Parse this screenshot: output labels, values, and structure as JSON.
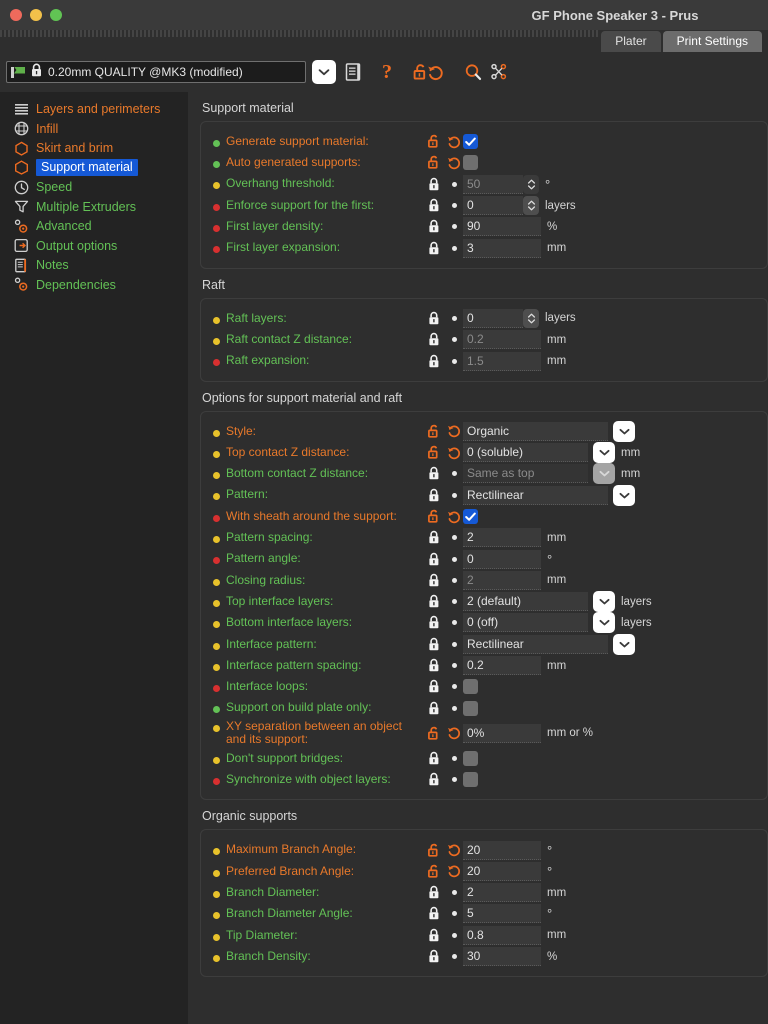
{
  "window": {
    "title": "GF Phone Speaker 3 - Prus",
    "controls": [
      "close-button",
      "minimize-button",
      "zoom-button"
    ]
  },
  "tabs": [
    {
      "label": "Plater",
      "active": false
    },
    {
      "label": "Print Settings",
      "active": true
    }
  ],
  "toolbar": {
    "preset_value": "0.20mm QUALITY @MK3 (modified)",
    "icons": [
      "combo-arrow-icon",
      "save-preset-icon",
      "question-mark-icon",
      "unlock-icon",
      "revert-icon",
      "search-icon",
      "compare-presets-icon"
    ]
  },
  "sidebar": {
    "items": [
      {
        "label": "Layers and perimeters",
        "icon": "layers-icon",
        "color": "orange",
        "selected": false
      },
      {
        "label": "Infill",
        "icon": "infill-icon",
        "color": "orange",
        "selected": false
      },
      {
        "label": "Skirt and brim",
        "icon": "skirt-icon",
        "color": "orange",
        "selected": false
      },
      {
        "label": "Support material",
        "icon": "support-icon",
        "color": "orange",
        "selected": true
      },
      {
        "label": "Speed",
        "icon": "speed-icon",
        "color": "green",
        "selected": false
      },
      {
        "label": "Multiple Extruders",
        "icon": "extruder-icon",
        "color": "green",
        "selected": false
      },
      {
        "label": "Advanced",
        "icon": "advanced-icon",
        "color": "green",
        "selected": false
      },
      {
        "label": "Output options",
        "icon": "output-icon",
        "color": "green",
        "selected": false
      },
      {
        "label": "Notes",
        "icon": "notes-icon",
        "color": "green",
        "selected": false
      },
      {
        "label": "Dependencies",
        "icon": "dependencies-icon",
        "color": "green",
        "selected": false
      }
    ]
  },
  "sections": [
    {
      "title": "Support material",
      "rows": [
        {
          "label": "Generate support material:",
          "label_color": "orange",
          "bullet": "#63c156",
          "lock": "unlocked",
          "revert": "arrow",
          "widget": "checkbox",
          "value": "checked"
        },
        {
          "label": "Auto generated supports:",
          "label_color": "orange",
          "bullet": "#63c156",
          "lock": "unlocked",
          "revert": "arrow",
          "widget": "checkbox",
          "value": "unchecked"
        },
        {
          "label": "Overhang threshold:",
          "label_color": "green",
          "bullet": "#e8c22b",
          "lock": "locked",
          "revert": "dot",
          "widget": "spinner",
          "value": "50",
          "disabled": true,
          "unit": "°"
        },
        {
          "label": "Enforce support for the first:",
          "label_color": "green",
          "bullet": "#d83030",
          "lock": "locked",
          "revert": "dot",
          "widget": "spinner",
          "value": "0",
          "unit": "layers"
        },
        {
          "label": "First layer density:",
          "label_color": "green",
          "bullet": "#d83030",
          "lock": "locked",
          "revert": "dot",
          "widget": "text",
          "value": "90",
          "unit": "%"
        },
        {
          "label": "First layer expansion:",
          "label_color": "green",
          "bullet": "#d83030",
          "lock": "locked",
          "revert": "dot",
          "widget": "text",
          "value": "3",
          "unit": "mm"
        }
      ]
    },
    {
      "title": "Raft",
      "rows": [
        {
          "label": "Raft layers:",
          "label_color": "green",
          "bullet": "#e8c22b",
          "lock": "locked",
          "revert": "dot",
          "widget": "spinner",
          "value": "0",
          "unit": "layers"
        },
        {
          "label": "Raft contact Z distance:",
          "label_color": "green",
          "bullet": "#e8c22b",
          "lock": "locked",
          "revert": "dot",
          "widget": "text",
          "value": "0.2",
          "disabled": true,
          "unit": "mm"
        },
        {
          "label": "Raft expansion:",
          "label_color": "green",
          "bullet": "#d83030",
          "lock": "locked",
          "revert": "dot",
          "widget": "text",
          "value": "1.5",
          "disabled": true,
          "unit": "mm"
        }
      ]
    },
    {
      "title": "Options for support material and raft",
      "rows": [
        {
          "label": "Style:",
          "label_color": "orange",
          "bullet": "#e8c22b",
          "lock": "unlocked",
          "revert": "arrow",
          "widget": "dropdown",
          "value": "Organic",
          "unit": ""
        },
        {
          "label": "Top contact Z distance:",
          "label_color": "orange",
          "bullet": "#e8c22b",
          "lock": "unlocked",
          "revert": "arrow",
          "widget": "dropdown",
          "value": "0 (soluble)",
          "unit": "mm"
        },
        {
          "label": "Bottom contact Z distance:",
          "label_color": "green",
          "bullet": "#e8c22b",
          "lock": "locked",
          "revert": "dot",
          "widget": "dropdown",
          "value": "Same as top",
          "disabled": true,
          "unit": "mm"
        },
        {
          "label": "Pattern:",
          "label_color": "green",
          "bullet": "#e8c22b",
          "lock": "locked",
          "revert": "dot",
          "widget": "dropdown",
          "value": "Rectilinear",
          "unit": ""
        },
        {
          "label": "With sheath around the support:",
          "label_color": "orange",
          "bullet": "#d83030",
          "lock": "unlocked",
          "revert": "arrow",
          "widget": "checkbox",
          "value": "checked"
        },
        {
          "label": "Pattern spacing:",
          "label_color": "green",
          "bullet": "#e8c22b",
          "lock": "locked",
          "revert": "dot",
          "widget": "text",
          "value": "2",
          "unit": "mm"
        },
        {
          "label": "Pattern angle:",
          "label_color": "green",
          "bullet": "#d83030",
          "lock": "locked",
          "revert": "dot",
          "widget": "text",
          "value": "0",
          "unit": "°"
        },
        {
          "label": "Closing radius:",
          "label_color": "green",
          "bullet": "#e8c22b",
          "lock": "locked",
          "revert": "dot",
          "widget": "text",
          "value": "2",
          "disabled": true,
          "unit": "mm"
        },
        {
          "label": "Top interface layers:",
          "label_color": "green",
          "bullet": "#e8c22b",
          "lock": "locked",
          "revert": "dot",
          "widget": "dropdown",
          "value": "2 (default)",
          "unit": "layers"
        },
        {
          "label": "Bottom interface layers:",
          "label_color": "green",
          "bullet": "#e8c22b",
          "lock": "locked",
          "revert": "dot",
          "widget": "dropdown",
          "value": "0 (off)",
          "unit": "layers"
        },
        {
          "label": "Interface pattern:",
          "label_color": "green",
          "bullet": "#e8c22b",
          "lock": "locked",
          "revert": "dot",
          "widget": "dropdown",
          "value": "Rectilinear",
          "unit": ""
        },
        {
          "label": "Interface pattern spacing:",
          "label_color": "green",
          "bullet": "#e8c22b",
          "lock": "locked",
          "revert": "dot",
          "widget": "text",
          "value": "0.2",
          "unit": "mm"
        },
        {
          "label": "Interface loops:",
          "label_color": "green",
          "bullet": "#d83030",
          "lock": "locked",
          "revert": "dot",
          "widget": "checkbox",
          "value": "unchecked"
        },
        {
          "label": "Support on build plate only:",
          "label_color": "green",
          "bullet": "#63c156",
          "lock": "locked",
          "revert": "dot",
          "widget": "checkbox",
          "value": "unchecked"
        },
        {
          "label": "XY separation between an object and its support:",
          "label_color": "orange",
          "bullet": "#e8c22b",
          "lock": "unlocked",
          "revert": "arrow",
          "widget": "text",
          "value": "0%",
          "unit": "mm or %",
          "two_line": true
        },
        {
          "label": "Don't support bridges:",
          "label_color": "green",
          "bullet": "#e8c22b",
          "lock": "locked",
          "revert": "dot",
          "widget": "checkbox",
          "value": "unchecked"
        },
        {
          "label": "Synchronize with object layers:",
          "label_color": "green",
          "bullet": "#d83030",
          "lock": "locked",
          "revert": "dot",
          "widget": "checkbox",
          "value": "unchecked"
        }
      ]
    },
    {
      "title": "Organic supports",
      "rows": [
        {
          "label": "Maximum Branch Angle:",
          "label_color": "orange",
          "bullet": "#e8c22b",
          "lock": "unlocked",
          "revert": "arrow",
          "widget": "text",
          "value": "20",
          "unit": "°"
        },
        {
          "label": "Preferred Branch Angle:",
          "label_color": "orange",
          "bullet": "#e8c22b",
          "lock": "unlocked",
          "revert": "arrow",
          "widget": "text",
          "value": "20",
          "unit": "°"
        },
        {
          "label": "Branch Diameter:",
          "label_color": "green",
          "bullet": "#e8c22b",
          "lock": "locked",
          "revert": "dot",
          "widget": "text",
          "value": "2",
          "unit": "mm"
        },
        {
          "label": "Branch Diameter Angle:",
          "label_color": "green",
          "bullet": "#e8c22b",
          "lock": "locked",
          "revert": "dot",
          "widget": "text",
          "value": "5",
          "unit": "°"
        },
        {
          "label": "Tip Diameter:",
          "label_color": "green",
          "bullet": "#e8c22b",
          "lock": "locked",
          "revert": "dot",
          "widget": "text",
          "value": "0.8",
          "unit": "mm"
        },
        {
          "label": "Branch Density:",
          "label_color": "green",
          "bullet": "#e8c22b",
          "lock": "locked",
          "revert": "dot",
          "widget": "text",
          "value": "30",
          "unit": "%"
        }
      ]
    }
  ],
  "colors": {
    "accent_orange": "#ed6b21",
    "modified_orange": "#e8792b",
    "system_green": "#63c156",
    "selection_blue": "#1559d6",
    "bg_main": "#2e2e2e",
    "bg_sidebar": "#232323"
  }
}
